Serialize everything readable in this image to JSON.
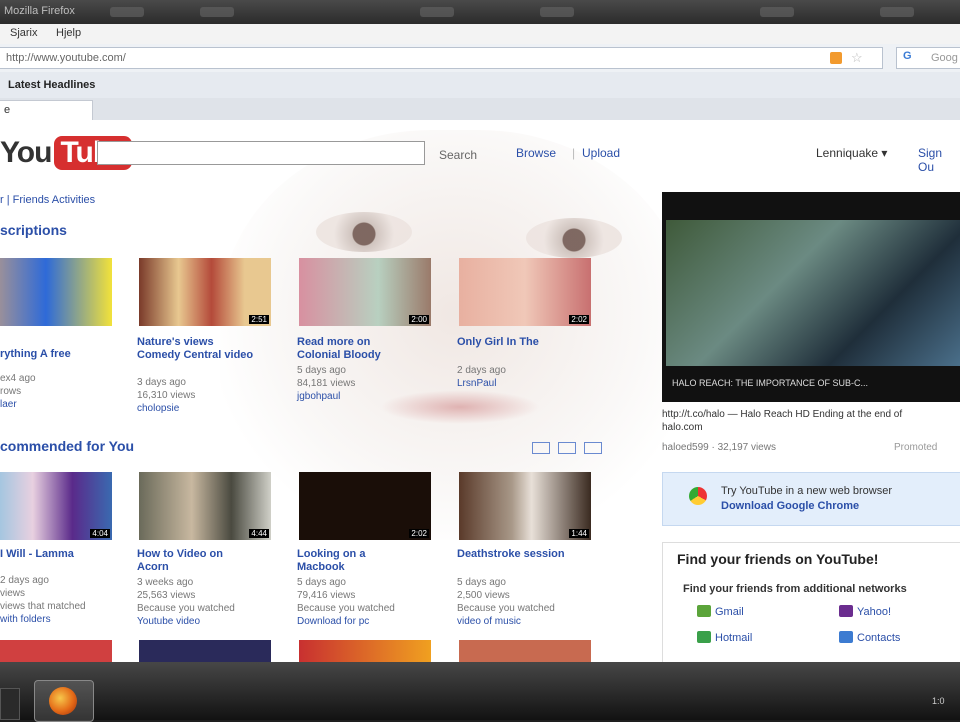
{
  "window": {
    "title": "Mozilla Firefox"
  },
  "menu": {
    "history": "Sjarix",
    "help": "Hjelp"
  },
  "address_bar": {
    "url": "http://www.youtube.com/",
    "search_engine": "G",
    "search_placeholder": "Goog"
  },
  "bookmarks": {
    "latest_headlines": "Latest Headlines"
  },
  "tabs": [
    {
      "label": "e"
    }
  ],
  "youtube": {
    "logo_you": "You",
    "logo_tube": "Tube",
    "search_button": "Search",
    "browse": "Browse",
    "upload": "Upload",
    "separator": "|",
    "username": "Lenniquake ▾",
    "sign_out": "Sign Ou",
    "breadcrumb": "r | Friends Activities",
    "subscriptions_heading": "scriptions",
    "recommended_heading": "commended for You",
    "subscriptions": [
      {
        "title_line1": "rything A free",
        "title_line2": "",
        "meta1": "ex4 ago",
        "meta2": "rows",
        "meta3": "laer",
        "duration": ""
      },
      {
        "title_line1": "Nature's views",
        "title_line2": "Comedy Central video",
        "meta1": "3 days ago",
        "meta2": "16,310 views",
        "meta3": "cholopsie",
        "duration": "2:51"
      },
      {
        "title_line1": "Read more on",
        "title_line2": "Colonial Bloody",
        "meta1": "5 days ago",
        "meta2": "84,181 views",
        "meta3": "jgbohpaul",
        "duration": "2:00"
      },
      {
        "title_line1": "Only Girl In The",
        "title_line2": "",
        "meta1": "2 days ago",
        "meta2": "",
        "meta3": "LrsnPaul",
        "duration": "2:02"
      }
    ],
    "recommended": [
      {
        "title_line1": "I Will - Lamma",
        "title_line2": "",
        "meta1": "2 days ago",
        "meta2": "views",
        "meta3": "views that matched",
        "meta4": "with folders",
        "duration": "4:04"
      },
      {
        "title_line1": "How to Video on",
        "title_line2": "Acorn",
        "meta1": "3 weeks ago",
        "meta2": "25,563 views",
        "meta3": "Because you watched",
        "meta4": "Youtube video",
        "duration": "4:44"
      },
      {
        "title_line1": "Looking on a",
        "title_line2": "Macbook",
        "meta1": "5 days ago",
        "meta2": "79,416 views",
        "meta3": "Because you watched",
        "meta4": "Download for pc",
        "duration": "2:02"
      },
      {
        "title_line1": "Deathstroke session",
        "title_line2": "",
        "meta1": "5 days ago",
        "meta2": "2,500 views",
        "meta3": "Because you watched",
        "meta4": "video of music",
        "duration": "1:44"
      }
    ],
    "featured": {
      "caption": "HALO REACH: THE IMPORTANCE OF SUB-C...",
      "description": "http://t.co/halo — Halo Reach HD Ending at the end of",
      "description2": "halo.com",
      "by": "haloed599 · 32,197 views",
      "by_right": "Promoted"
    },
    "chrome_promo": {
      "line1": "Try YouTube in a new web browser",
      "line2": "Download Google Chrome"
    },
    "friends": {
      "heading": "Find your friends on YouTube!",
      "subheading": "Find your friends from additional networks",
      "networks": [
        {
          "label": "Gmail",
          "color": "#5ba43a"
        },
        {
          "label": "Yahoo!",
          "color": "#6b2d8f"
        },
        {
          "label": "Hotmail",
          "color": "#3aa04a"
        },
        {
          "label": "Contacts",
          "color": "#3c7bd1"
        }
      ]
    }
  },
  "taskbar": {
    "clock": "1:0"
  },
  "colors": {
    "link": "#2b4fa8",
    "logo_red": "#d62f2f"
  }
}
